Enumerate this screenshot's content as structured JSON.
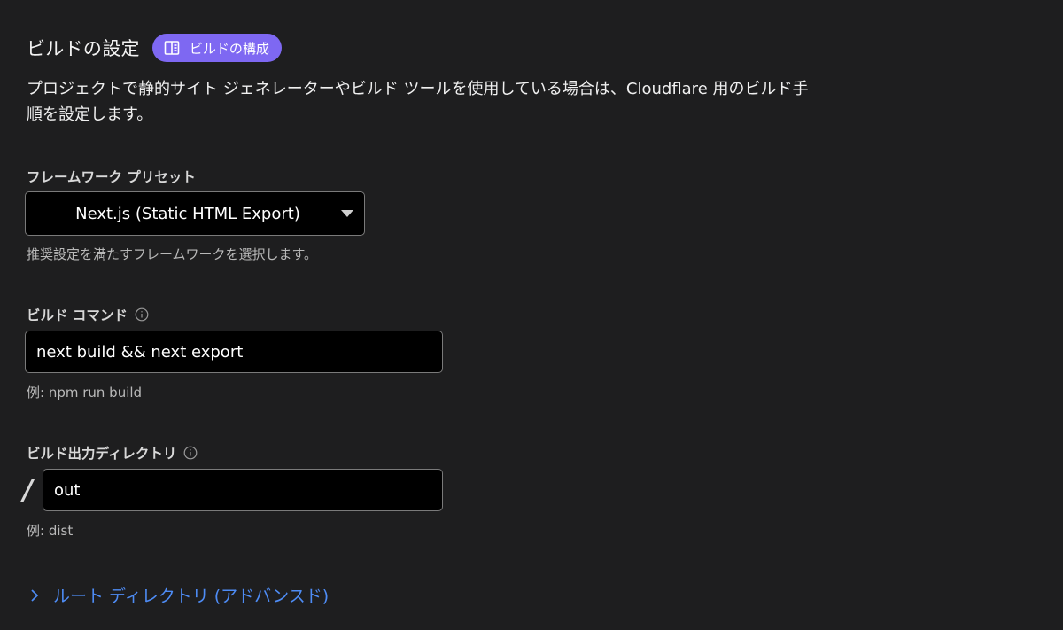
{
  "header": {
    "title": "ビルドの設定",
    "doc_link_label": "ビルドの構成"
  },
  "description": "プロジェクトで静的サイト ジェネレーターやビルド ツールを使用している場合は、Cloudflare 用のビルド手順を設定します。",
  "framework": {
    "label": "フレームワーク プリセット",
    "selected": "Next.js (Static HTML Export)",
    "hint": "推奨設定を満たすフレームワークを選択します。"
  },
  "build_command": {
    "label": "ビルド コマンド",
    "value": "next build && next export",
    "hint": "例: npm run build"
  },
  "output_dir": {
    "label": "ビルド出力ディレクトリ",
    "prefix": "/",
    "value": "out",
    "hint": "例: dist"
  },
  "advanced": {
    "label": "ルート ディレクトリ (アドバンスド)"
  },
  "colors": {
    "background": "#1e1e1f",
    "badge": "#7e68f2",
    "link": "#4e8cf5",
    "input_background": "#000000",
    "input_border": "#7a7a7a"
  },
  "icons": {
    "doc": "book-icon",
    "info": "info-icon",
    "dropdown": "caret-down-icon",
    "expand": "chevron-right-icon"
  }
}
